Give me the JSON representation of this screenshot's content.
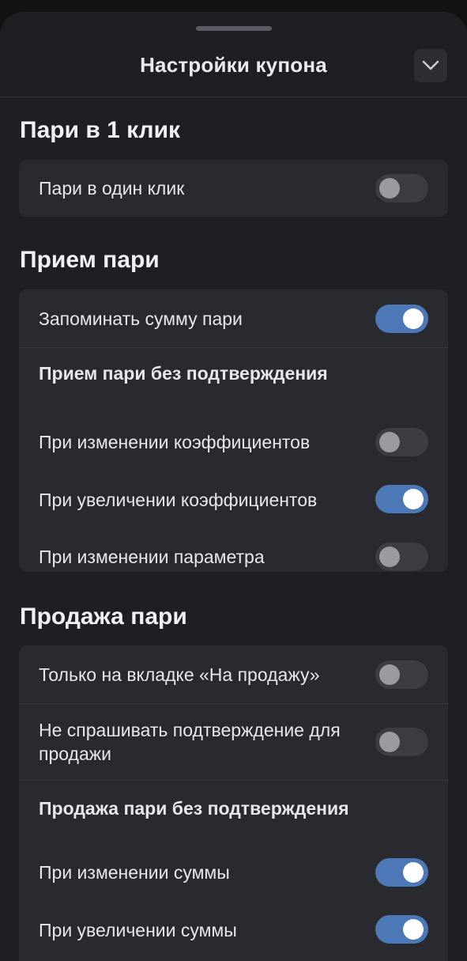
{
  "header": {
    "title": "Настройки купона"
  },
  "sections": [
    {
      "title": "Пари в 1 клик",
      "rows": [
        {
          "label": "Пари в один клик",
          "enabled": false
        }
      ]
    },
    {
      "title": "Прием пари",
      "rows": [
        {
          "label": "Запоминать сумму пари",
          "enabled": true
        },
        {
          "label": "Прием пари без подтверждения"
        },
        {
          "label": "При изменении коэффициентов",
          "enabled": false
        },
        {
          "label": "При увеличении коэффициентов",
          "enabled": true
        },
        {
          "label": "При изменении параметра",
          "enabled": false
        }
      ]
    },
    {
      "title": "Продажа пари",
      "rows": [
        {
          "label": "Только на вкладке «На продажу»",
          "enabled": false
        },
        {
          "label": "Не спрашивать подтверждение для продажи",
          "enabled": false
        },
        {
          "label": "Продажа пари без подтверждения"
        },
        {
          "label": "При изменении суммы",
          "enabled": true
        },
        {
          "label": "При увеличении суммы",
          "enabled": true
        }
      ]
    }
  ],
  "colors": {
    "background": "#1e1f23",
    "card": "#282a2f",
    "toggle_on": "#4d78b8",
    "toggle_off": "#3b3d43"
  }
}
